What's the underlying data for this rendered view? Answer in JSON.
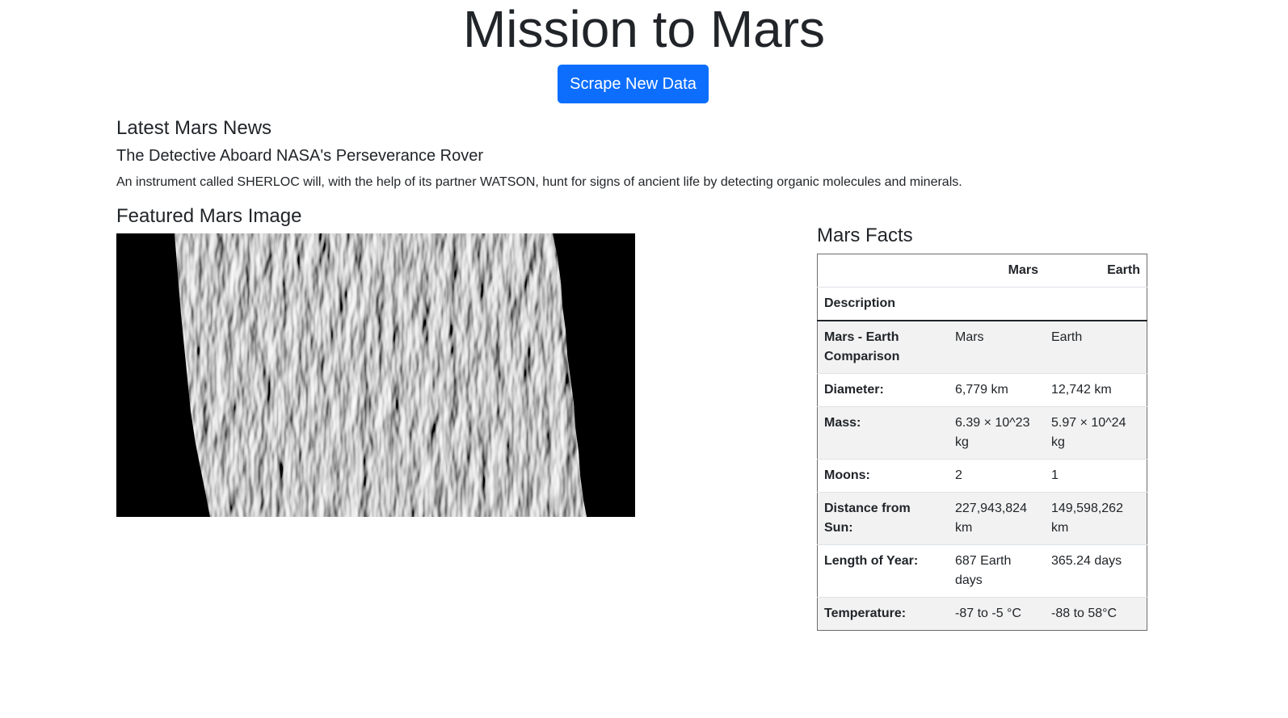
{
  "header": {
    "title": "Mission to Mars",
    "scrape_button": "Scrape New Data"
  },
  "news": {
    "heading": "Latest Mars News",
    "title": "The Detective Aboard NASA's Perseverance Rover",
    "paragraph": "An instrument called SHERLOC will, with the help of its partner WATSON, hunt for signs of ancient life by detecting organic molecules and minerals."
  },
  "featured": {
    "heading": "Featured Mars Image"
  },
  "facts": {
    "heading": "Mars Facts",
    "columns": [
      "",
      "Mars",
      "Earth"
    ],
    "index_label": "Description",
    "rows": [
      {
        "label": "Mars - Earth Comparison",
        "mars": "Mars",
        "earth": "Earth"
      },
      {
        "label": "Diameter:",
        "mars": "6,779 km",
        "earth": "12,742 km"
      },
      {
        "label": "Mass:",
        "mars": "6.39 × 10^23 kg",
        "earth": "5.97 × 10^24 kg"
      },
      {
        "label": "Moons:",
        "mars": "2",
        "earth": "1"
      },
      {
        "label": "Distance from Sun:",
        "mars": "227,943,824 km",
        "earth": "149,598,262 km"
      },
      {
        "label": "Length of Year:",
        "mars": "687 Earth days",
        "earth": "365.24 days"
      },
      {
        "label": "Temperature:",
        "mars": "-87 to -5 °C",
        "earth": "-88 to 58°C"
      }
    ]
  },
  "colors": {
    "primary_button": "#0d6efd",
    "text": "#212529",
    "striped_row": "#f2f2f2"
  }
}
